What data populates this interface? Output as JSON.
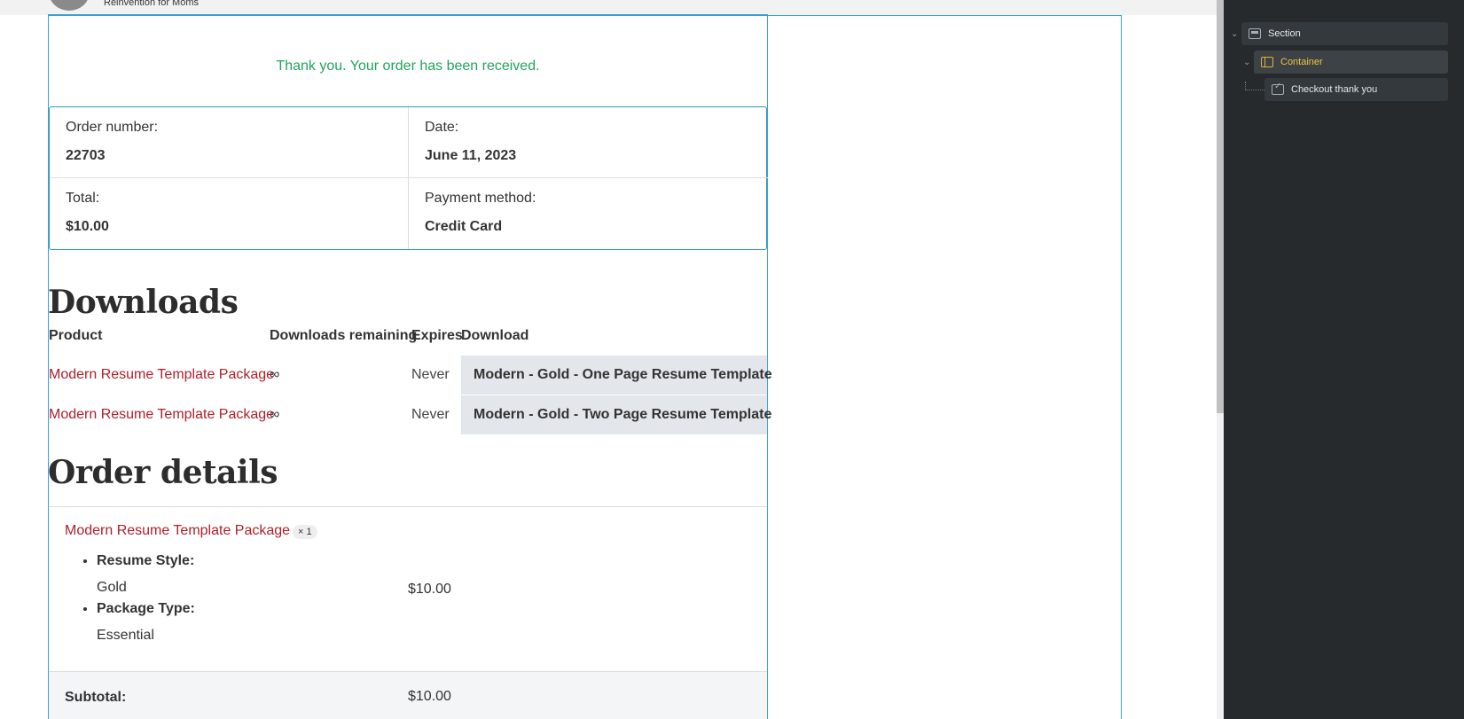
{
  "header": {
    "tagline": "Reinvention for Moms"
  },
  "thank_you_message": "Thank you. Your order has been received.",
  "order_overview": {
    "order_number_label": "Order number:",
    "order_number": "22703",
    "date_label": "Date:",
    "date": "June 11, 2023",
    "total_label": "Total:",
    "total": "$10.00",
    "payment_label": "Payment method:",
    "payment": "Credit Card"
  },
  "downloads": {
    "title": "Downloads",
    "columns": [
      "Product",
      "Downloads remaining",
      "Expires",
      "Download"
    ],
    "rows": [
      {
        "product": "Modern Resume Template Package",
        "remaining": "∞",
        "expires": "Never",
        "download": "Modern - Gold - One Page Resume Template"
      },
      {
        "product": "Modern Resume Template Package",
        "remaining": "∞",
        "expires": "Never",
        "download": "Modern - Gold - Two Page Resume Template"
      }
    ]
  },
  "order_details": {
    "title": "Order details",
    "item": {
      "name": "Modern Resume Template Package",
      "qty": "× 1",
      "meta": [
        {
          "key": "Resume Style:",
          "value": "Gold"
        },
        {
          "key": "Package Type:",
          "value": "Essential"
        }
      ],
      "price": "$10.00"
    },
    "subtotal_label": "Subtotal:",
    "subtotal": "$10.00"
  },
  "navigator": {
    "items": [
      {
        "label": "Section"
      },
      {
        "label": "Container"
      },
      {
        "label": "Checkout thank you"
      }
    ]
  },
  "colors": {
    "accent_outline": "#3aa0d8",
    "success": "#1fa55a",
    "link": "#b01e28",
    "navigator_bg": "#262a2d",
    "navigator_active": "#f0c23a"
  }
}
